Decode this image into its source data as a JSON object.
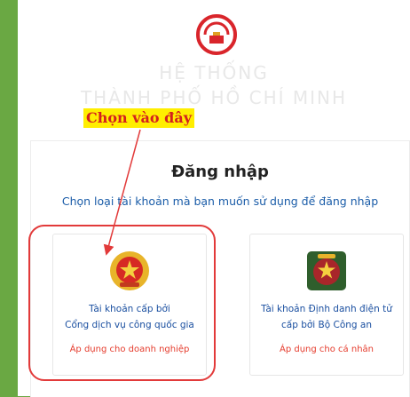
{
  "header": {
    "system_title_line1": "HỆ THỐNG",
    "system_title_line2": "THÀNH PHỐ HỒ CHÍ MINH",
    "logo_icon": "city-logo-icon"
  },
  "annotation": {
    "label": "Chọn vào đây"
  },
  "login": {
    "title": "Đăng nhập",
    "subtitle": "Chọn loại tài khoản mà bạn muốn sử dụng để đăng nhập",
    "options": [
      {
        "icon": "national-emblem-icon",
        "line1": "Tài khoản cấp bởi",
        "line2": "Cổng dịch vụ công quốc gia",
        "note": "Áp dụng cho doanh nghiệp"
      },
      {
        "icon": "police-badge-icon",
        "line1": "Tài khoản Định danh điện tử",
        "line2": "cấp bởi Bộ Công an",
        "note": "Áp dụng cho cá nhân"
      }
    ]
  },
  "colors": {
    "background_green": "#6aa843",
    "link_blue": "#1a5ca8",
    "note_red": "#e53b2c",
    "highlight_yellow": "#ffee00"
  }
}
